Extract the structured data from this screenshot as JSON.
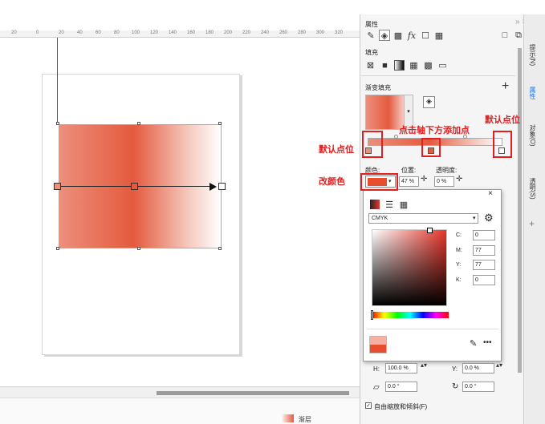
{
  "ruler": {
    "ticks": [
      "20",
      "0",
      "20",
      "40",
      "60",
      "80",
      "100",
      "120",
      "140",
      "160",
      "180",
      "200",
      "220",
      "240",
      "260",
      "280",
      "300",
      "320"
    ]
  },
  "annotations": {
    "default_stop_left": "默认点位",
    "default_stop_right": "默认点位",
    "add_stop_hint": "点击轴下方添加点",
    "change_color": "改颜色"
  },
  "panel": {
    "title": "属性",
    "title_buttons": "»  ×",
    "fill_section": "填充",
    "gradient_fill": "渐变填充",
    "color_label": "颜色:",
    "position_label": "位置:",
    "position_value": "47 %",
    "opacity_label": "透明度:",
    "opacity_value": "0 %"
  },
  "color_popup": {
    "close": "×",
    "model": "CMYK",
    "c_label": "C:",
    "c_value": "0",
    "m_label": "M:",
    "m_value": "77",
    "y_label": "Y:",
    "y_value": "77",
    "k_label": "K:",
    "k_value": "0",
    "more": "•••"
  },
  "transform": {
    "h_label": "H:",
    "h_value": "100.0 %",
    "y_label": "Y:",
    "y_value": "0.0 %",
    "skew_value": "0.0 °",
    "rotate_value": "0.0 °",
    "free_scale_label": "自由缩放和倾斜(F)"
  },
  "vertical_tabs": {
    "hint": "提示(N)",
    "properties": "属性",
    "objects": "对象(O)",
    "transparency": "透明(S)"
  },
  "status": {
    "text": "渐层"
  },
  "colors": {
    "accent": "#e84d2e",
    "annotation": "#e02020",
    "gradient_mid": "#e45a3e",
    "gradient_left": "#ec8f7b"
  }
}
